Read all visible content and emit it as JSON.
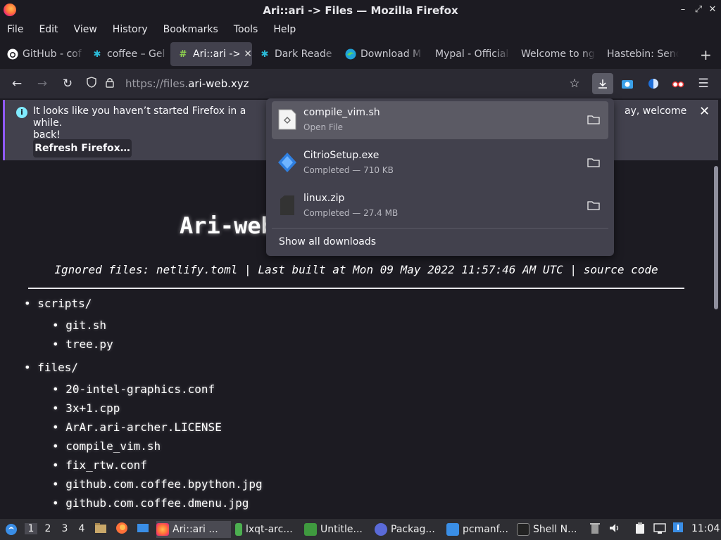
{
  "window": {
    "title": "Ari::ari -> Files — Mozilla Firefox",
    "controls": [
      "–",
      "⤢",
      "✕"
    ]
  },
  "menu": [
    "File",
    "Edit",
    "View",
    "History",
    "Bookmarks",
    "Tools",
    "Help"
  ],
  "tabs": [
    {
      "label": "GitHub - cof",
      "icon": "github-icon"
    },
    {
      "label": "coffee – Gel",
      "icon": "coffee-gel-icon"
    },
    {
      "label": "Ari::ari ->",
      "icon": "hash-icon",
      "active": true,
      "close": "✕"
    },
    {
      "label": "Dark Reade",
      "icon": "dark-reader-icon"
    },
    {
      "label": "Download M",
      "icon": "edge-icon"
    },
    {
      "label": "Mypal - Official",
      "icon": ""
    },
    {
      "label": "Welcome to ng",
      "icon": ""
    },
    {
      "label": "Hastebin: Send",
      "icon": ""
    }
  ],
  "newtab": "+",
  "nav": {
    "url_prefix": "https://files.",
    "url_domain": "ari-web.xyz"
  },
  "notification": {
    "text": "It looks like you haven’t started Firefox in a while.",
    "text_continued": "ay, welcome",
    "text_line2": "back!",
    "button": "Refresh Firefox…",
    "close": "✕"
  },
  "page": {
    "title": "Ari-web",
    "subtitle": "Ignored files: netlify.toml | Last built at Mon 09 May 2022 11:57:46 AM UTC | ",
    "source_link": "source code",
    "tree": [
      {
        "dir": "scripts/",
        "files": [
          "git.sh",
          "tree.py"
        ]
      },
      {
        "dir": "files/",
        "files": [
          "20-intel-graphics.conf",
          "3x+1.cpp",
          "ArAr.ari-archer.LICENSE",
          "compile_vim.sh",
          "fix_rtw.conf",
          "github.com.coffee.bpython.jpg",
          "github.com.coffee.dmenu.jpg"
        ]
      }
    ]
  },
  "downloads": {
    "items": [
      {
        "name": "compile_vim.sh",
        "status": "Open File"
      },
      {
        "name": "CitrioSetup.exe",
        "status": "Completed — 710 KB"
      },
      {
        "name": "linux.zip",
        "status": "Completed — 27.4 MB"
      }
    ],
    "show_all": "Show all downloads"
  },
  "taskbar": {
    "workspaces": [
      "1",
      "2",
      "3",
      "4"
    ],
    "windows": [
      {
        "label": "Ari::ari ...",
        "active": true
      },
      {
        "label": "lxqt-arc..."
      },
      {
        "label": "Untitle..."
      },
      {
        "label": "Packag..."
      },
      {
        "label": "pcmanf..."
      },
      {
        "label": "Shell N..."
      }
    ],
    "clock": "11:04"
  },
  "colors": {
    "accent": "#9059ff",
    "info": "#80ebff",
    "toolbar": "#2b2a33",
    "panel": "#42414d"
  }
}
